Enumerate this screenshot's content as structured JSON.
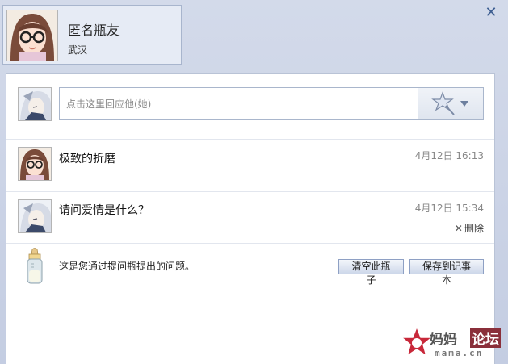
{
  "profile": {
    "name": "匿名瓶友",
    "location": "武汉"
  },
  "reply": {
    "placeholder": "点击这里回应他(她)"
  },
  "messages": [
    {
      "text": "极致的折磨",
      "time": "4月12日 16:13"
    },
    {
      "text": "请问爱情是什么？",
      "time": "4月12日 15:34",
      "delete_label": "删除"
    }
  ],
  "footer": {
    "note": "这是您通过提问瓶提出的问题。",
    "clear_label": "清空此瓶子",
    "save_label": "保存到记事本"
  },
  "icons": {
    "close": "close-icon",
    "emoji": "star-wand-icon",
    "dropdown": "triangle-down-icon",
    "bottle": "baby-bottle-icon"
  },
  "watermark": {
    "line1": "妈妈",
    "line2": "论坛",
    "line3": "mama.cn"
  },
  "colors": {
    "accent": "#3e5f92",
    "panel_bg": "#ffffff",
    "frame_bg": "#c9d2e6"
  }
}
